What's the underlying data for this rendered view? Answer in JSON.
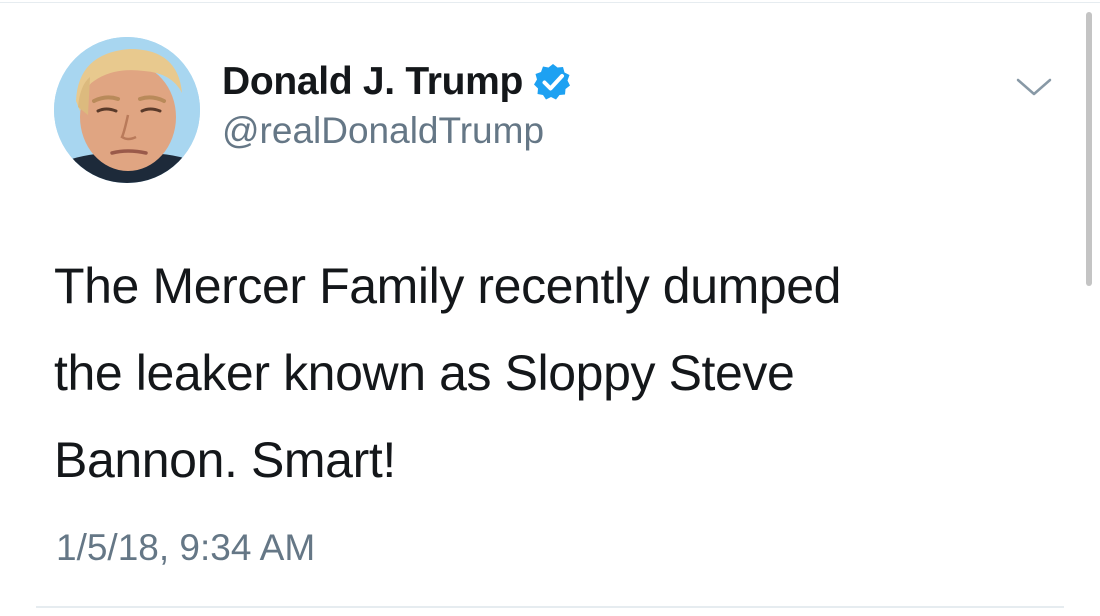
{
  "tweet": {
    "author": {
      "display_name": "Donald J. Trump",
      "handle": "@realDonaldTrump",
      "verified": true,
      "avatar_icon": "profile-photo"
    },
    "text": "The Mercer Family recently dumped\nthe leaker known as Sloppy Steve\nBannon. Smart!",
    "timestamp": "1/5/18, 9:34 AM",
    "menu_icon": "chevron-down-icon"
  },
  "colors": {
    "text_primary": "#14171a",
    "text_secondary": "#657786",
    "verified_badge": "#1da1f2",
    "divider": "#e6ecf0",
    "avatar_background": "#9fd1ee"
  }
}
